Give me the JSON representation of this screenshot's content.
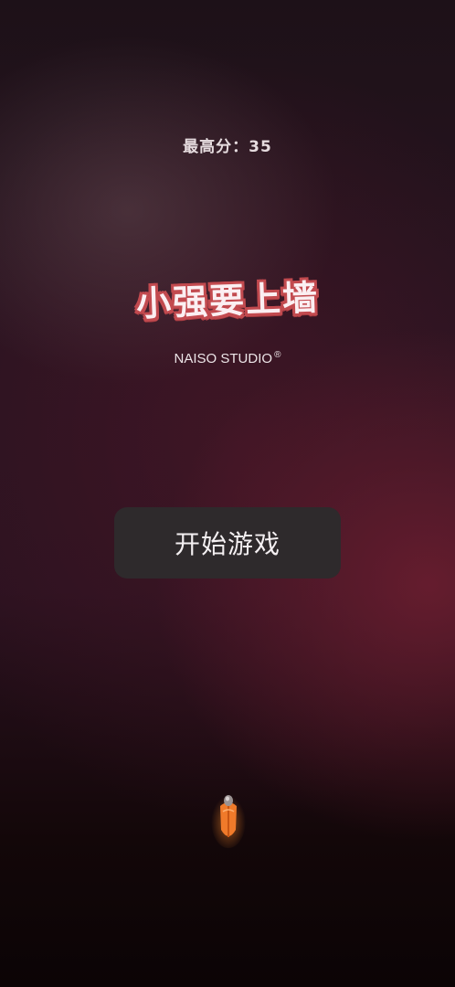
{
  "hud": {
    "high_score_text": "最高分：35"
  },
  "title": {
    "game_title": "小强要上墙",
    "studio": "NAISO STUDIO",
    "studio_mark": "®"
  },
  "menu": {
    "start_label": "开始游戏"
  },
  "player": {
    "icon": "cockroach-icon",
    "color": "#f07a2a"
  },
  "colors": {
    "title_outline": "#c24a4f",
    "button_bg": "#2e2a2c"
  }
}
